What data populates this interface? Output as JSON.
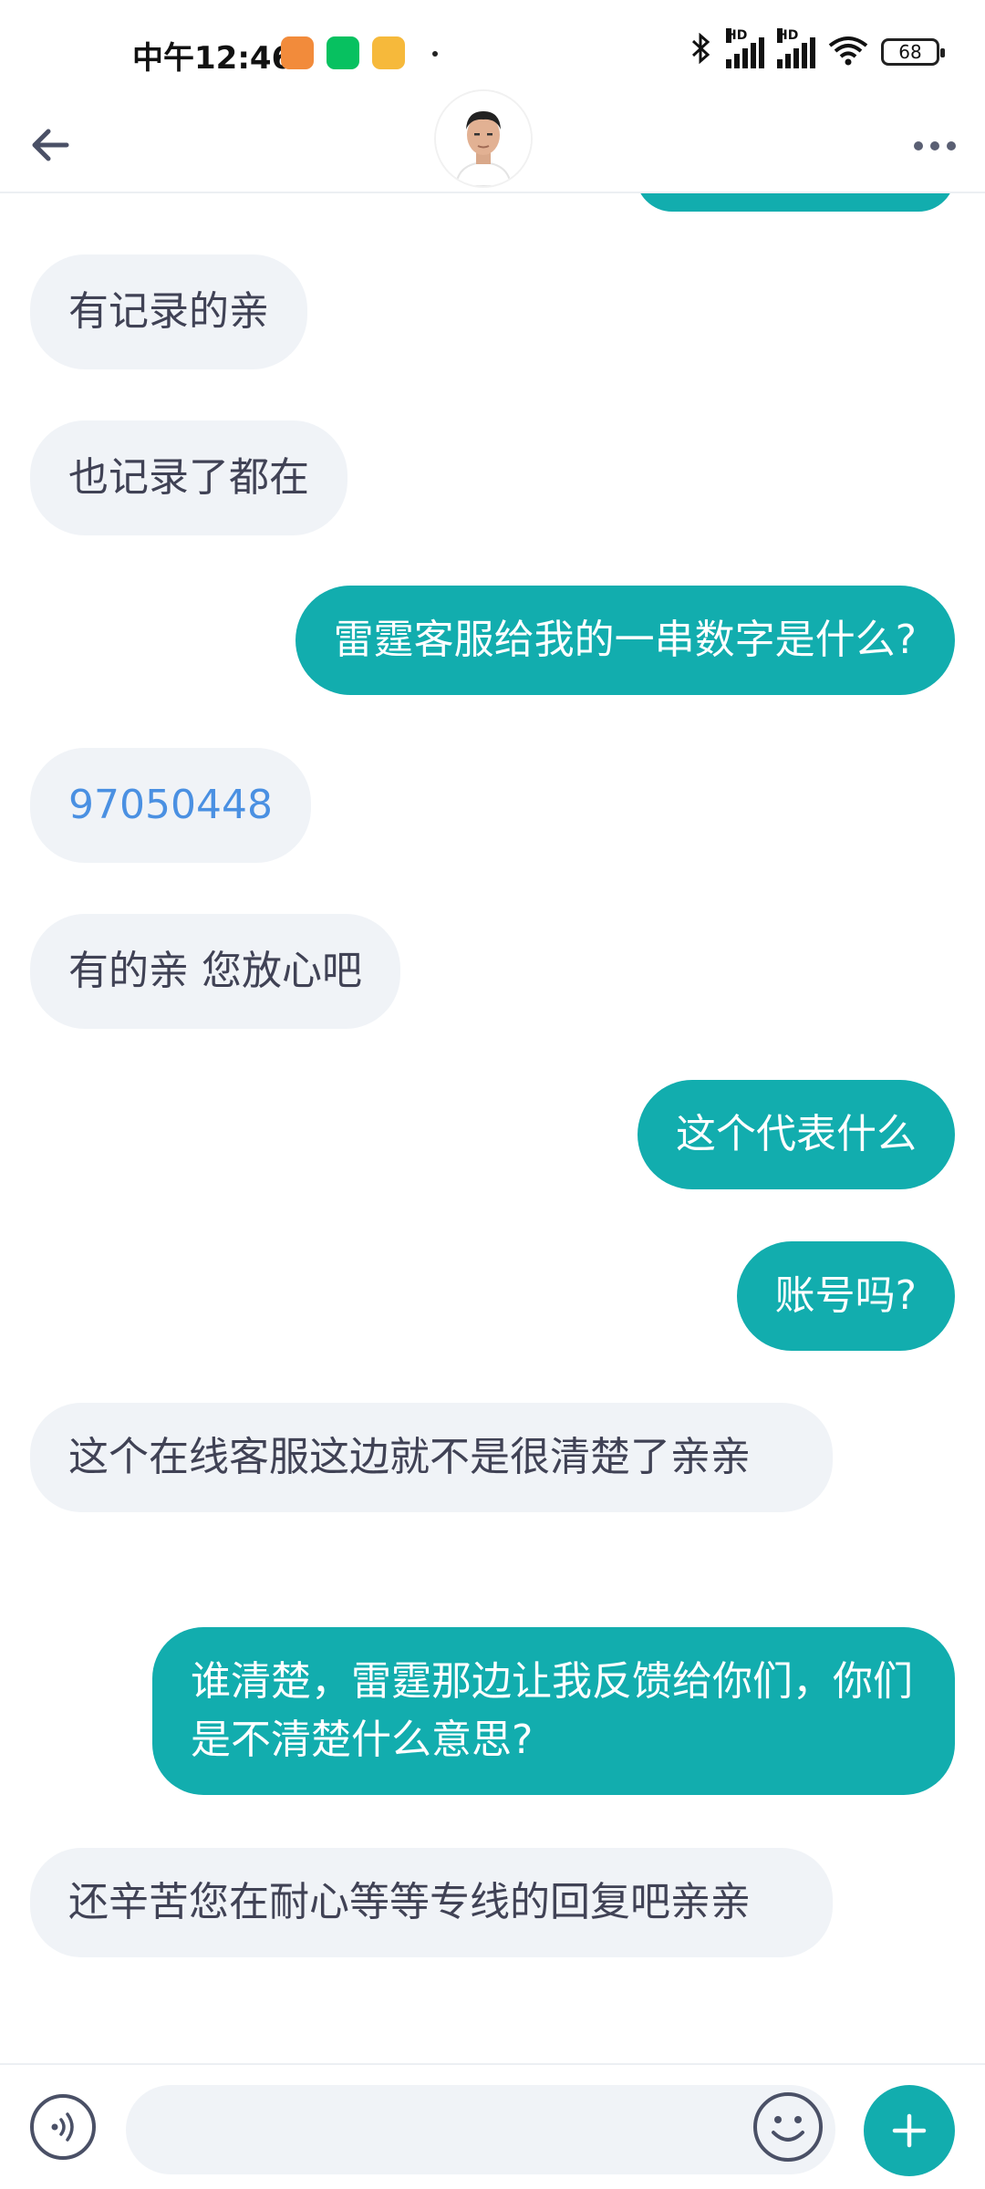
{
  "status_bar": {
    "time": "中午12:46",
    "battery": "68",
    "hd1": "HD",
    "hd2": "HD"
  },
  "header": {
    "back_icon": "arrow-left-icon",
    "more_icon": "more-horizontal-icon",
    "avatar_icon": "user-avatar"
  },
  "messages": [
    {
      "side": "in",
      "text": "有记录的亲"
    },
    {
      "side": "in",
      "text": "也记录了都在"
    },
    {
      "side": "out",
      "text": "雷霆客服给我的一串数字是什么?"
    },
    {
      "side": "in",
      "text": "97050448"
    },
    {
      "side": "in",
      "text": "有的亲 您放心吧"
    },
    {
      "side": "out",
      "text": "这个代表什么"
    },
    {
      "side": "out",
      "text": "账号吗?"
    },
    {
      "side": "in",
      "text": "这个在线客服这边就不是很清楚了亲亲"
    },
    {
      "side": "out",
      "text": "谁清楚，雷霆那边让我反馈给你们，你们是不清楚什么意思?"
    },
    {
      "side": "in",
      "text": "还辛苦您在耐心等等专线的回复吧亲亲"
    }
  ],
  "colors": {
    "accent": "#12adae",
    "incoming_bubble": "#f0f3f7",
    "incoming_text": "#404255",
    "link": "#4a90e2"
  },
  "input_bar": {
    "placeholder": "",
    "value": ""
  }
}
